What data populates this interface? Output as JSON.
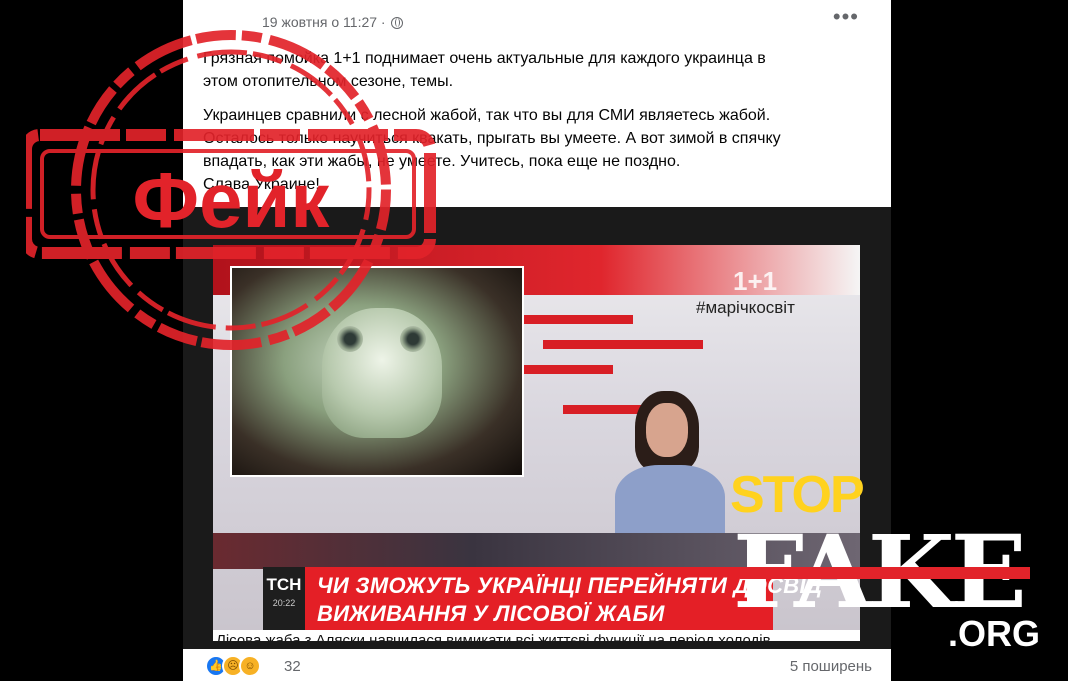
{
  "post": {
    "timestamp": "19 жовтня о 11:27 ·",
    "more_label": "•••",
    "paragraph1": [
      "Грязная помойка 1+1 поднимает очень актуальные для каждого украинца в",
      "этом отопительном сезоне, темы."
    ],
    "paragraph2": [
      "Украинцев сравнили с лесной жабой, так что вы для СМИ являетесь жабой.",
      "Осталось только научиться квакать, прыгать вы умеете. А вот зимой в спячку",
      "впадать, как эти жабы, не умеете. Учитесь, пока еще не поздно.",
      "Слава Украине!"
    ]
  },
  "tv": {
    "channel_logo": "1+1",
    "hashtag": "#марічкосвіт",
    "tsn_label": "ТСН",
    "tsn_time": "20:22",
    "headline_line1": "ЧИ ЗМОЖУТЬ УКРАЇНЦІ  ПЕРЕЙНЯТИ ДОСВІД",
    "headline_line2": "ВИЖИВАННЯ У ЛІСОВОЇ ЖАБИ",
    "crawl": "Лісова жаба з Аляски навчилася вимикати всі життєві функції на період холодів"
  },
  "footer": {
    "reactions": [
      "like-icon",
      "sad-icon",
      "haha-icon"
    ],
    "reaction_count": "32",
    "shares": "5 поширень"
  },
  "overlay": {
    "stamp_text": "Фейк",
    "stop": "STOP",
    "fake": "FAKE",
    "org": ".ORG",
    "colors": {
      "stamp_red": "#e2232a",
      "stop_yellow": "#ffd21e"
    }
  }
}
